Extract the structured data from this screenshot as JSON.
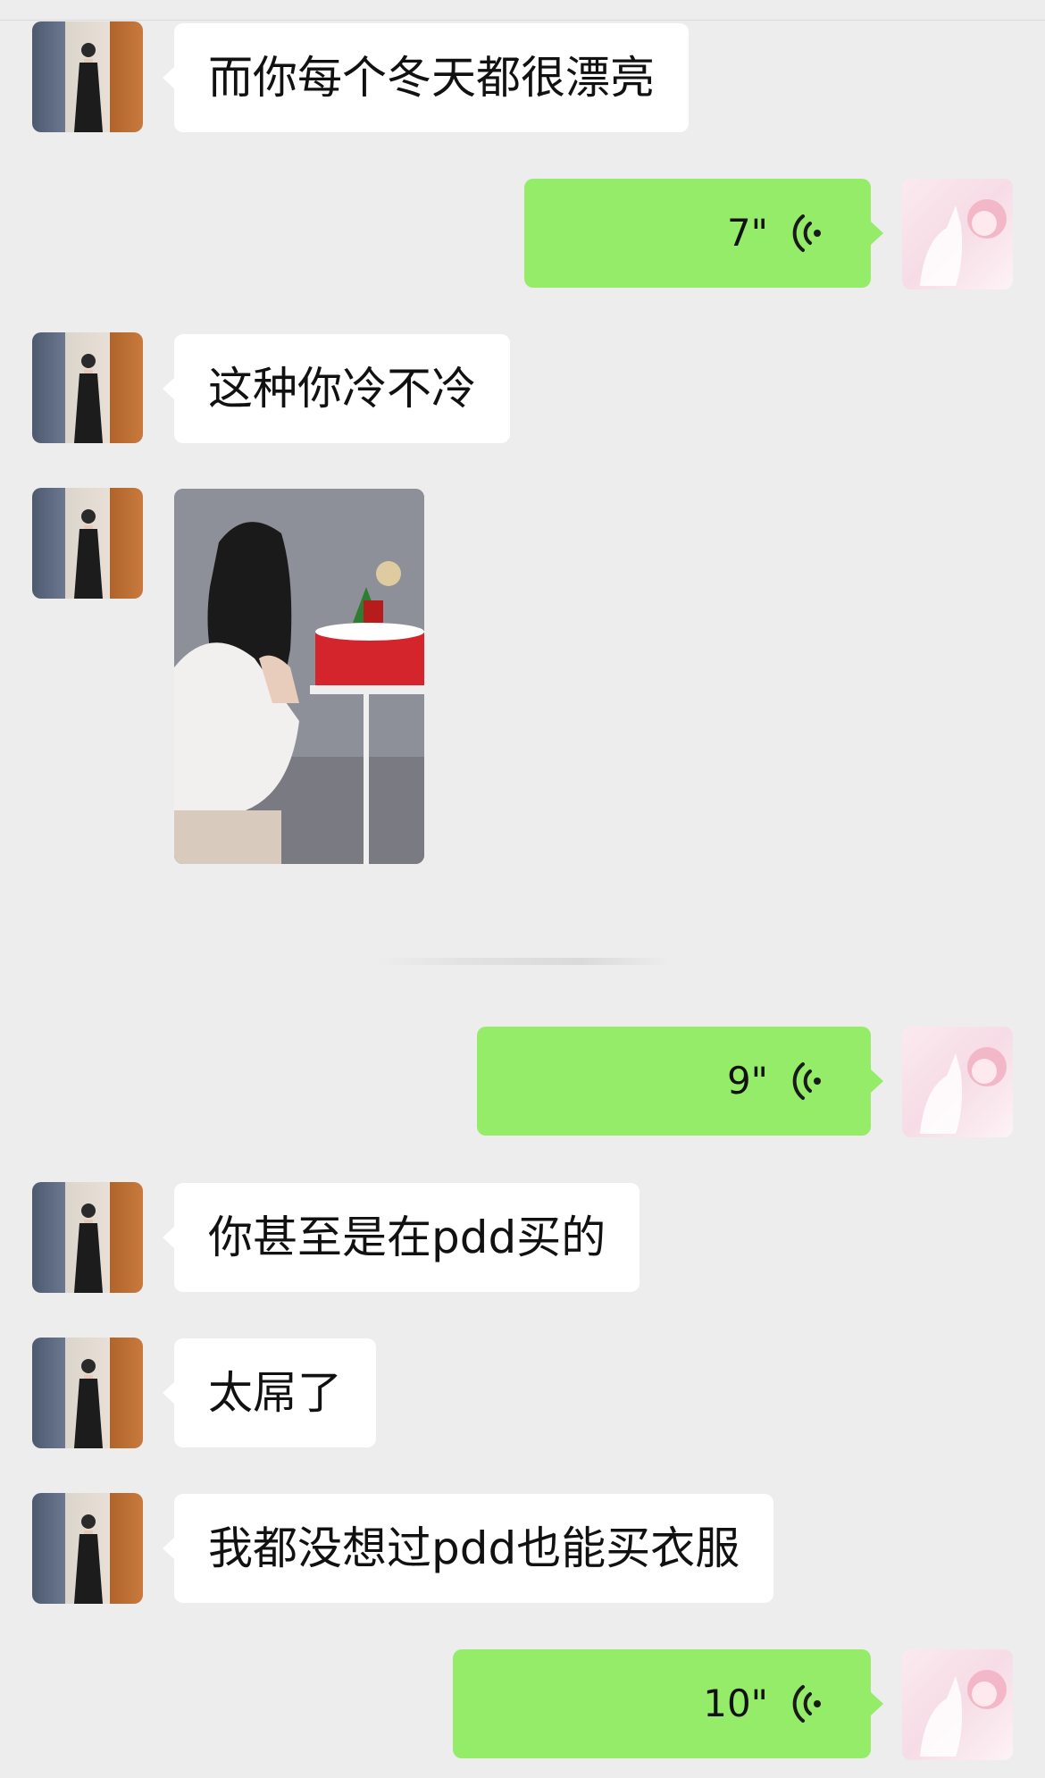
{
  "messages": [
    {
      "type": "text",
      "side": "in",
      "text": "而你每个冬天都很漂亮"
    },
    {
      "type": "voice",
      "side": "out",
      "duration": "7\""
    },
    {
      "type": "text",
      "side": "in",
      "text": "这种你冷不冷"
    },
    {
      "type": "image",
      "side": "in"
    },
    {
      "type": "voice",
      "side": "out",
      "duration": "9\""
    },
    {
      "type": "text",
      "side": "in",
      "text": "你甚至是在pdd买的"
    },
    {
      "type": "text",
      "side": "in",
      "text": "太屌了"
    },
    {
      "type": "text",
      "side": "in",
      "text": "我都没想过pdd也能买衣服"
    },
    {
      "type": "voice",
      "side": "out",
      "duration": "10\""
    }
  ],
  "icons": {
    "voice": "voice-wave-icon"
  },
  "colors": {
    "background": "#ededed",
    "incoming_bubble": "#ffffff",
    "outgoing_bubble": "#95ec69"
  }
}
